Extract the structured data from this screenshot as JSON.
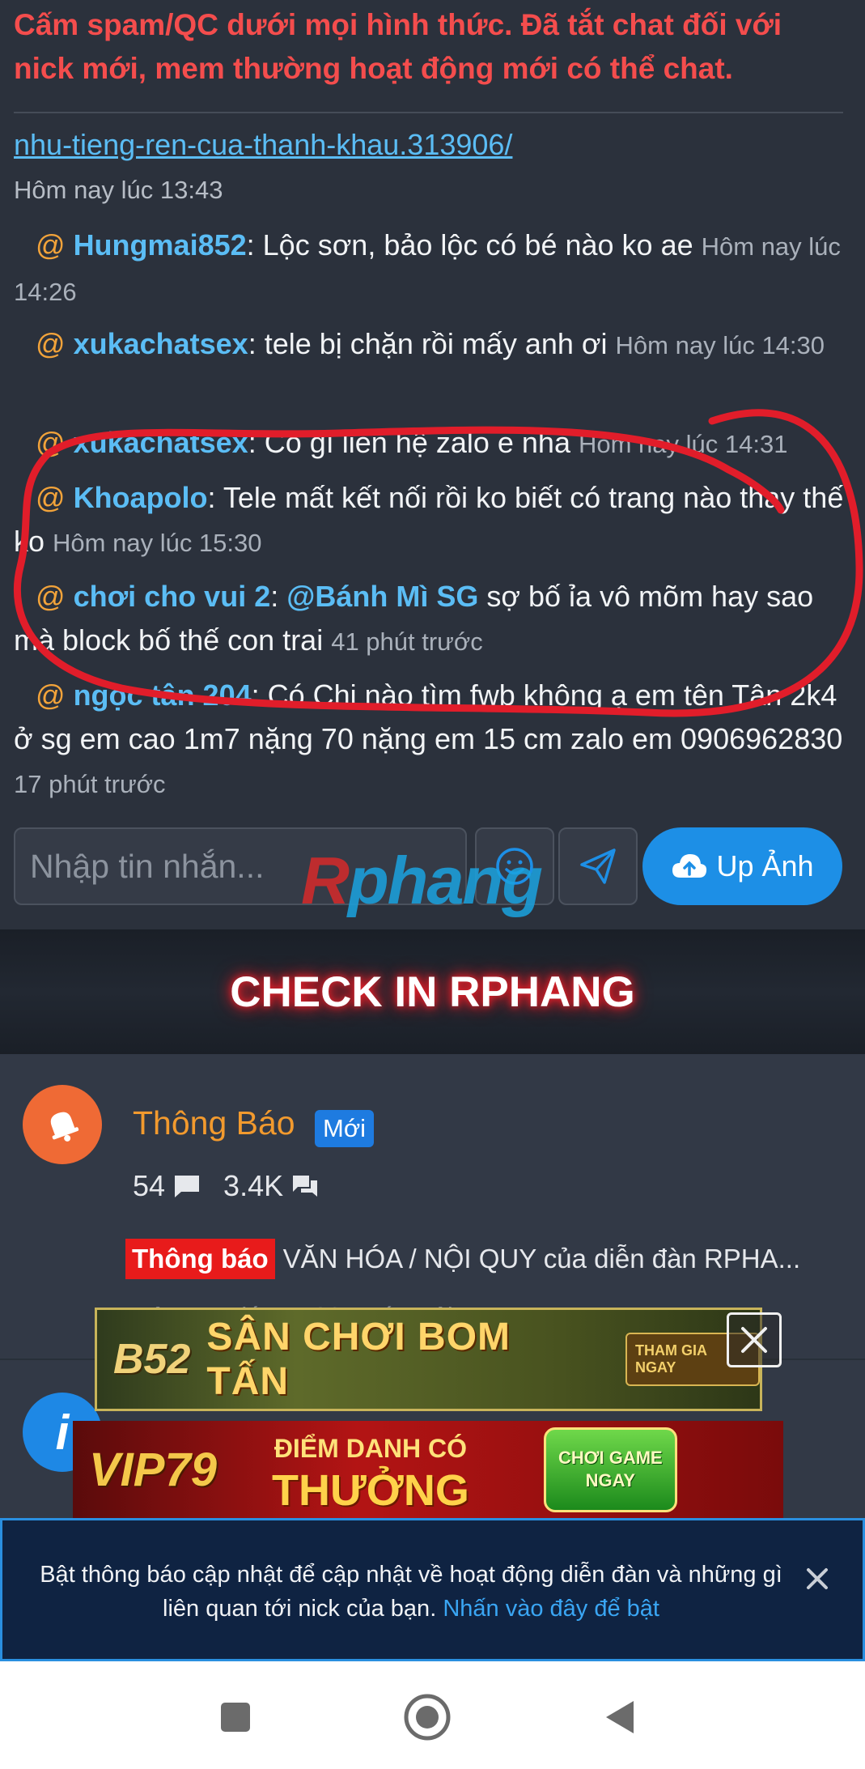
{
  "chat": {
    "rules_text": "Cấm spam/QC dưới mọi hình thức. Đã tắt chat đối với nick mới, mem thường hoạt động mới có thể chat.",
    "thread_link": "nhu-tieng-ren-cua-thanh-khau.313906/",
    "thread_link_time": "Hôm nay lúc 13:43",
    "messages": [
      {
        "at": "@",
        "user": "Hungmai852",
        "text": ": Lộc sơn, bảo lộc có bé nào ko ae ",
        "time": "Hôm nay lúc 14:26"
      },
      {
        "at": "@",
        "user": "xukachatsex",
        "text": ": tele bị chặn rồi mấy anh ơi ",
        "time": "Hôm nay lúc 14:30"
      },
      {
        "at": "@",
        "user": "xukachatsex",
        "text": ": Có gì liên hệ zalo e nha ",
        "time": "Hôm nay lúc 14:31"
      },
      {
        "at": "@",
        "user": "Khoapolo",
        "text": ": Tele mất kết nối rồi ko biết có trang nào thay thế ko ",
        "time": "Hôm nay lúc 15:30"
      },
      {
        "at": "@",
        "user": "chơi cho vui 2",
        "text_pre": ": ",
        "mention": "@Bánh Mì SG",
        "text": " sợ bố ỉa vô mõm hay sao mà block bố thế con trai ",
        "time": "41 phút trước"
      },
      {
        "at": "@",
        "user": "ngọc tân 204",
        "text": ": Có Chị nào tìm fwb không ạ em tên Tân 2k4 ở sg em cao 1m7 nặng 70 nặng em 15 cm zalo em 0906962830 ",
        "time": "17 phút trước"
      }
    ],
    "input_placeholder": "Nhập tin nhắn...",
    "upload_label": "Up Ảnh",
    "watermark_r": "R",
    "watermark_rest": "phang"
  },
  "checkin": {
    "label": "CHECK IN RPHANG"
  },
  "forum": {
    "title": "Thông Báo",
    "badge": "Mới",
    "threads_count": "54",
    "messages_count": "3.4K",
    "latest_tag": "Thông báo",
    "latest_title": "VĂN HÓA / NỘI QUY của diễn đàn RPHA...",
    "latest_meta": "Hôm qua lúc 11:06 · Bé Ngôi"
  },
  "ads": {
    "ad1_logo": "B52",
    "ad1_slogan": "SÂN CHƠI BOM TẤN",
    "ad1_cta": "THAM GIA NGAY",
    "ad2_logo": "VIP79",
    "ad2_line1": "ĐIỂM DANH CÓ",
    "ad2_line2": "THƯỞNG",
    "ad2_cta": "CHƠI GAME NGAY"
  },
  "notify": {
    "text": "Bật thông báo cập nhật để cập nhật về hoạt động diễn đàn và những gì liên quan tới nick của bạn. ",
    "cta": "Nhấn vào đây để bật"
  },
  "colors": {
    "background": "#2b313c",
    "username": "#5bbdf5",
    "at_sign": "#f2a33a",
    "rules_red": "#f44d4d",
    "accent_blue": "#1d8fe6",
    "annotation_red": "#e11d2a"
  }
}
